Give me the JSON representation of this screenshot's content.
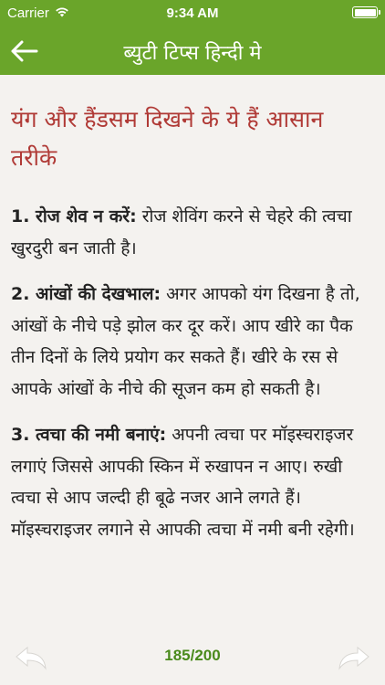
{
  "status_bar": {
    "carrier": "Carrier",
    "time": "9:34 AM",
    "wifi_icon": "wifi-icon",
    "battery_icon": "battery-icon"
  },
  "nav": {
    "back_icon": "arrow-left-icon",
    "title": "ब्युटी टिप्स हिन्दी मे"
  },
  "article": {
    "title": "यंग और हैंडसम दिखने के ये हैं आसान तरीके",
    "sections": [
      {
        "heading": "1. रोज शेव न करें:",
        "text": " रोज शेविंग करने से चेहरे की त्वचा खुरदुरी बन जाती है।"
      },
      {
        "heading": "2. आंखों की देखभाल:",
        "text": " अगर आपको यंग दिखना है तो, आंखों के नीचे पडे़ झोल कर दूर करें। आप खीरे का पैक तीन दिनों के लिये प्रयोग कर सकते हैं। खीरे के रस से आपके आंखों के नीचे की सूजन कम हो सकती है।"
      },
      {
        "heading": "3. त्वचा की नमी बनाएं:",
        "text": " अपनी त्वचा पर मॉइस्चराइजर लगाएं जिससे आपकी स्किन में रुखापन न आए। रुखी त्वचा से आप जल्दी ही बूढे नजर आने लगते हैं। मॉइस्चराइजर लगाने से आपकी त्वचा में नमी बनी रहेगी।"
      }
    ]
  },
  "bottom_bar": {
    "prev_icon": "reply-left-arrow-icon",
    "next_icon": "share-right-arrow-icon",
    "page_indicator": "185/200"
  },
  "colors": {
    "brand_green": "#6aa52a",
    "title_red": "#b03a36",
    "page_counter_green": "#4a8a1c",
    "background": "#f4f2ef"
  }
}
